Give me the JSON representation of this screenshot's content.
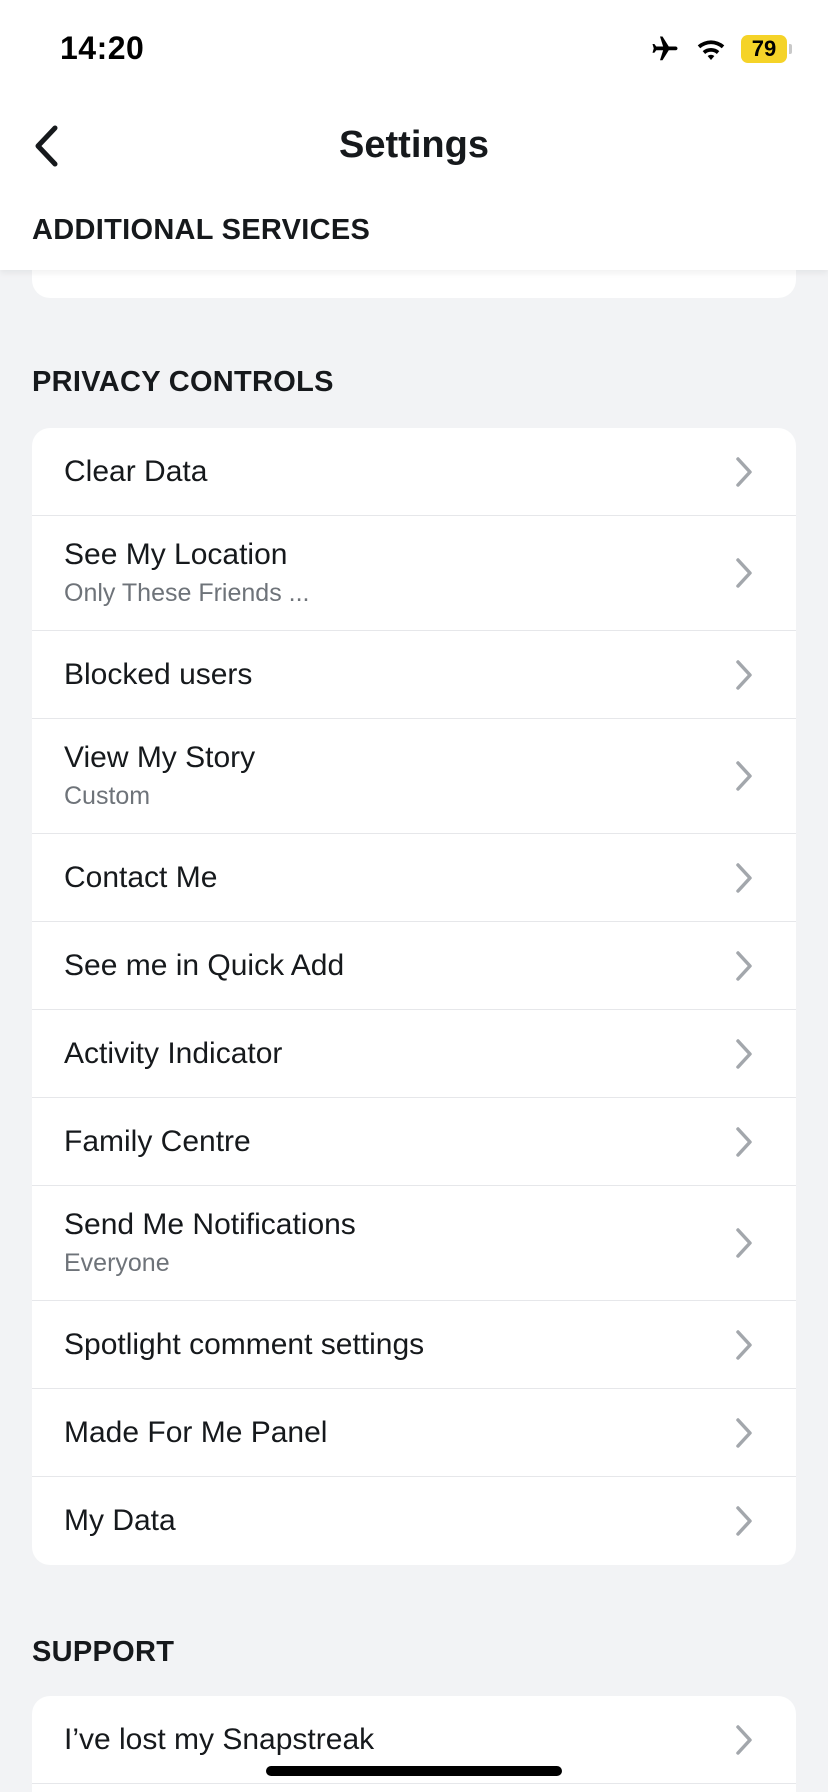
{
  "status_bar": {
    "time": "14:20",
    "battery_level": "79",
    "icons": [
      "airplane-icon",
      "wifi-icon",
      "battery-icon"
    ],
    "battery_color": "#f5d328"
  },
  "header": {
    "title": "Settings",
    "back_icon": "chevron-left-icon",
    "section_title": "ADDITIONAL SERVICES"
  },
  "privacy": {
    "section_title": "PRIVACY CONTROLS",
    "items": [
      {
        "label": "Clear Data",
        "sub": ""
      },
      {
        "label": "See My Location",
        "sub": "Only These Friends ..."
      },
      {
        "label": "Blocked users",
        "sub": ""
      },
      {
        "label": "View My Story",
        "sub": "Custom"
      },
      {
        "label": "Contact Me",
        "sub": ""
      },
      {
        "label": "See me in Quick Add",
        "sub": ""
      },
      {
        "label": "Activity Indicator",
        "sub": ""
      },
      {
        "label": "Family Centre",
        "sub": ""
      },
      {
        "label": "Send Me Notifications",
        "sub": "Everyone"
      },
      {
        "label": "Spotlight comment settings",
        "sub": ""
      },
      {
        "label": "Made For Me Panel",
        "sub": ""
      },
      {
        "label": "My Data",
        "sub": ""
      }
    ]
  },
  "support": {
    "section_title": "SUPPORT",
    "items": [
      {
        "label": "I’ve lost my Snapstreak",
        "sub": ""
      }
    ]
  },
  "colors": {
    "background": "#f2f3f5",
    "card": "#ffffff",
    "text": "#16191c",
    "subtext": "#6e7379",
    "chevron": "#a3a7ac"
  }
}
